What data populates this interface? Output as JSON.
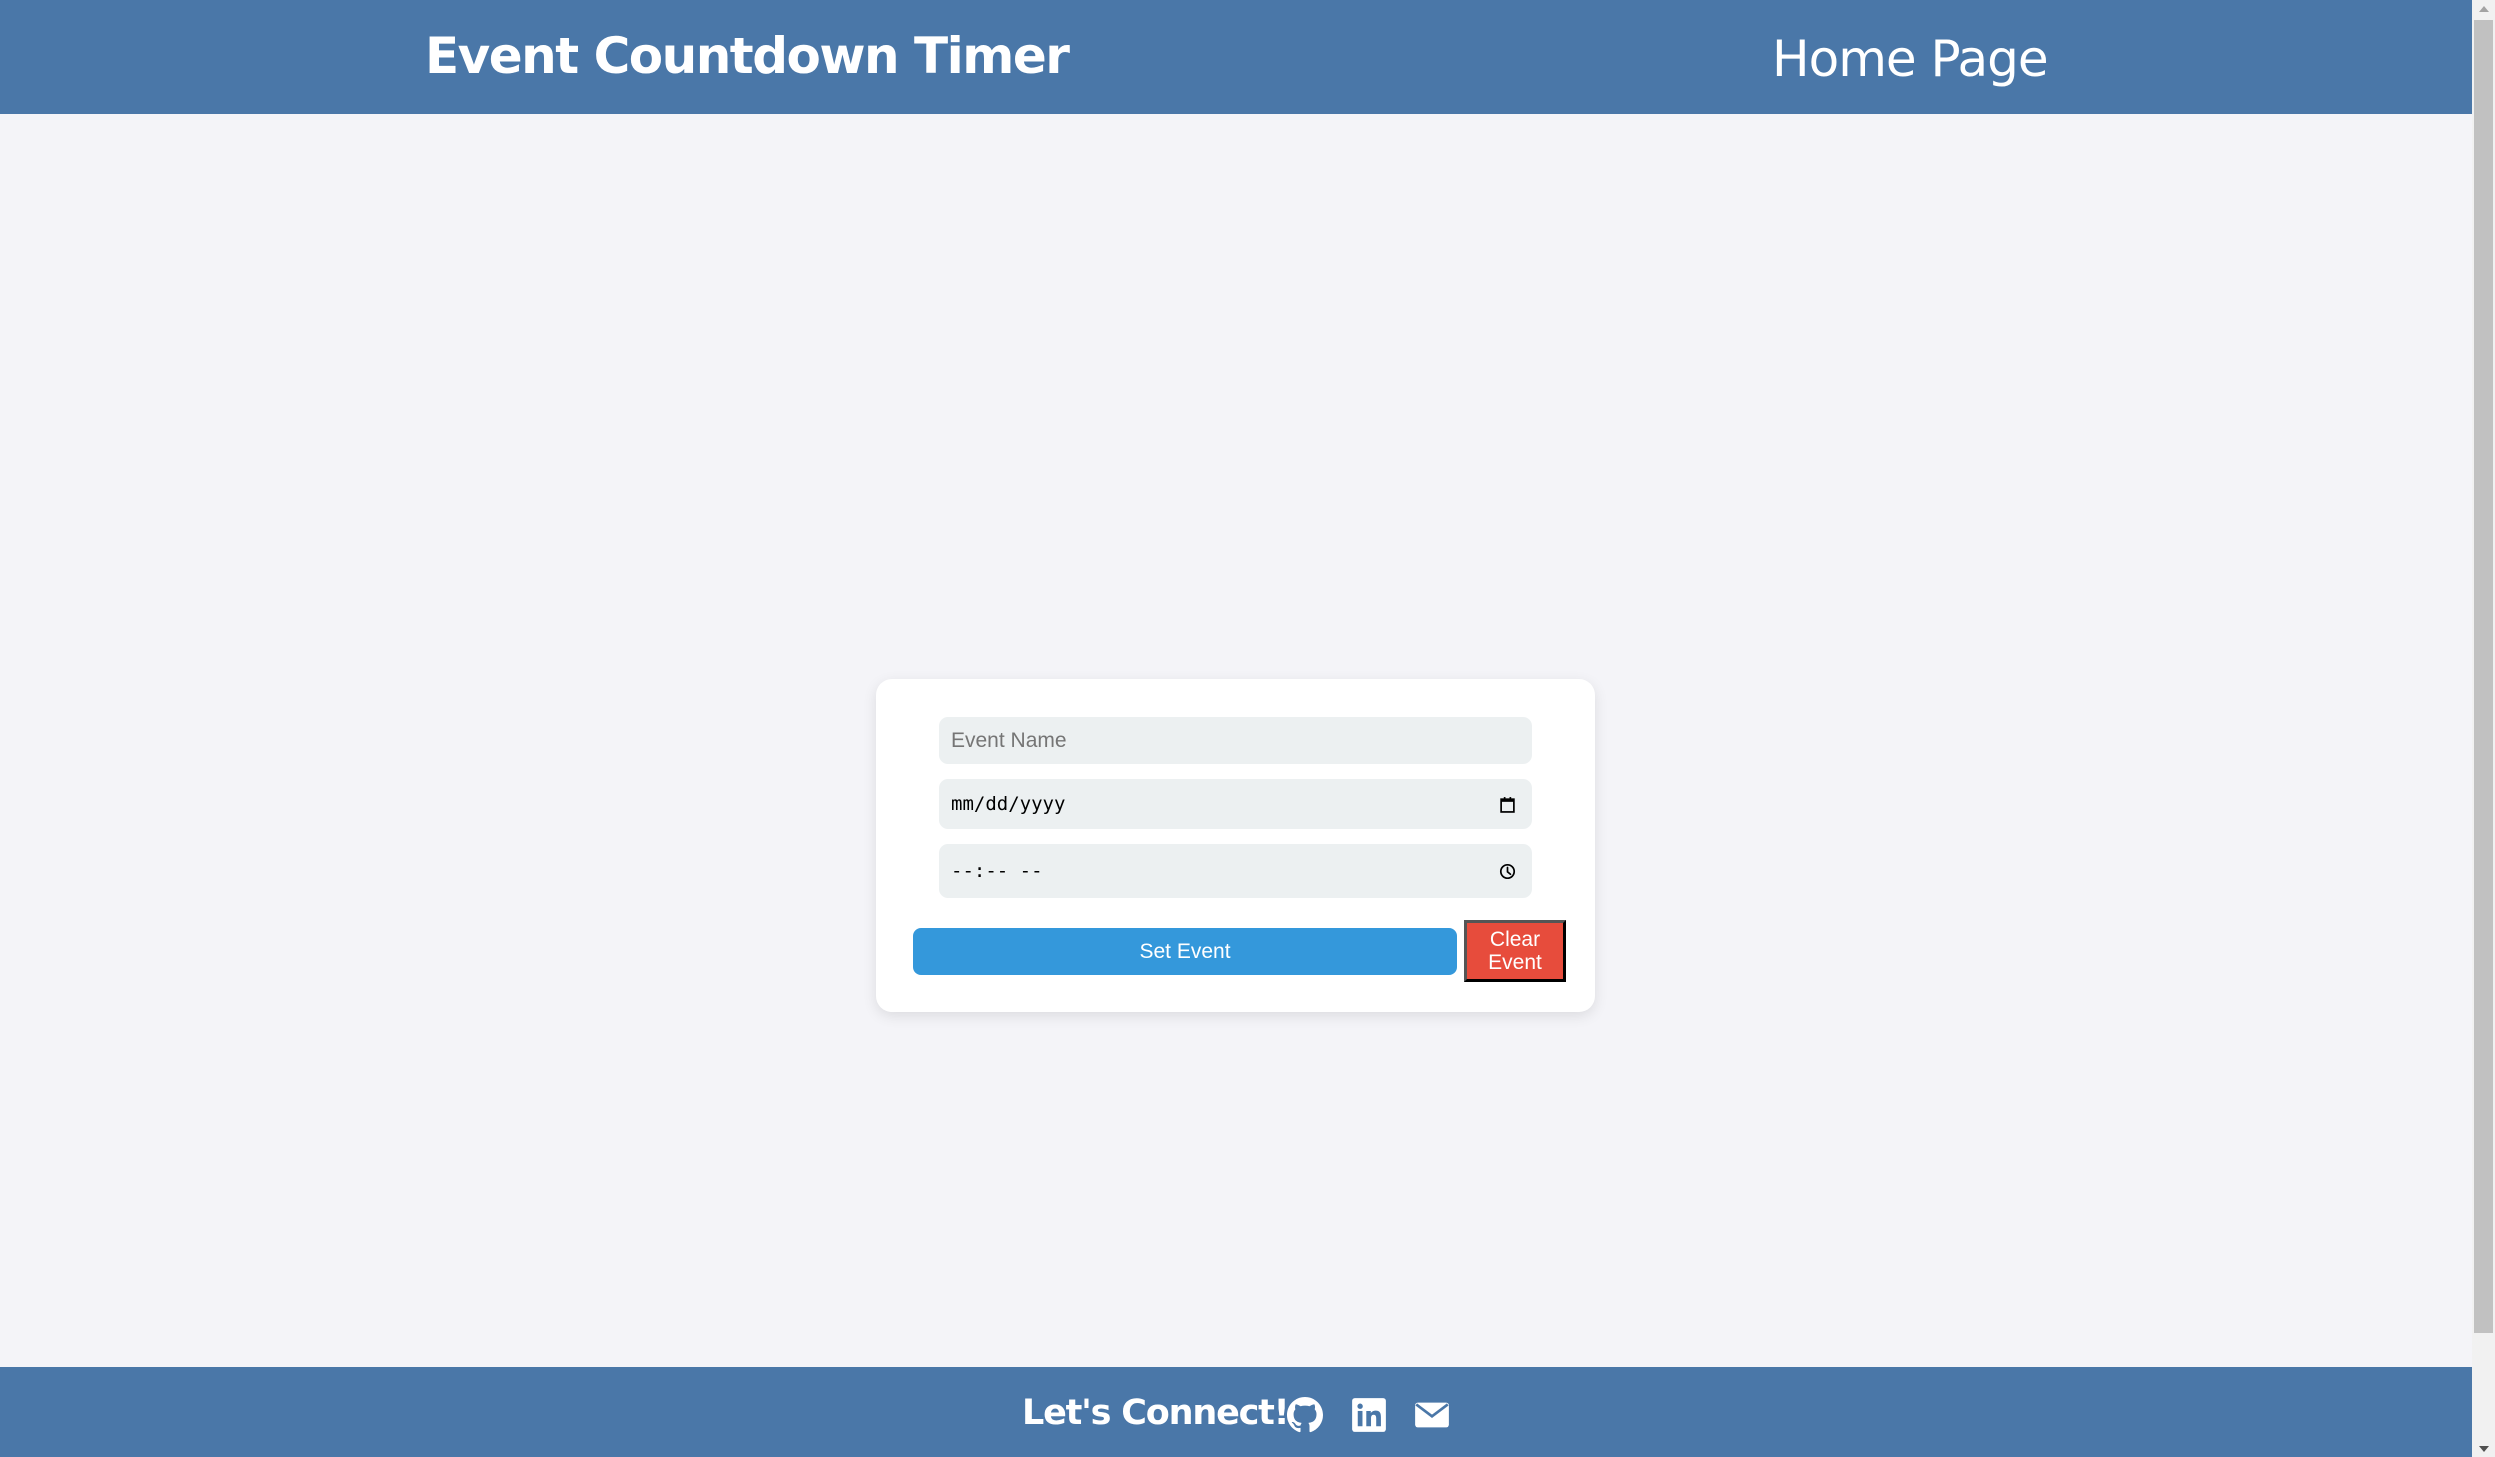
{
  "header": {
    "title": "Event Countdown Timer",
    "nav_home": "Home Page"
  },
  "form": {
    "event_name": {
      "value": "",
      "placeholder": "Event Name"
    },
    "date": {
      "display": "mm/dd/yyyy",
      "value": "",
      "icon": "calendar-icon"
    },
    "time": {
      "display": "--:-- --",
      "value": "",
      "icon": "clock-icon"
    },
    "set_button": "Set Event",
    "clear_button_line1": "Clear",
    "clear_button_line2": "Event"
  },
  "footer": {
    "connect_label": "Let's Connect!",
    "social": [
      {
        "name": "GitHub",
        "icon": "github-icon"
      },
      {
        "name": "LinkedIn",
        "icon": "linkedin-icon"
      },
      {
        "name": "Email",
        "icon": "mail-icon"
      }
    ]
  },
  "colors": {
    "header_bg": "#4a77a8",
    "page_bg": "#f4f4f8",
    "input_bg": "#ecf0f1",
    "primary": "#3498db",
    "danger": "#e74c3c"
  }
}
